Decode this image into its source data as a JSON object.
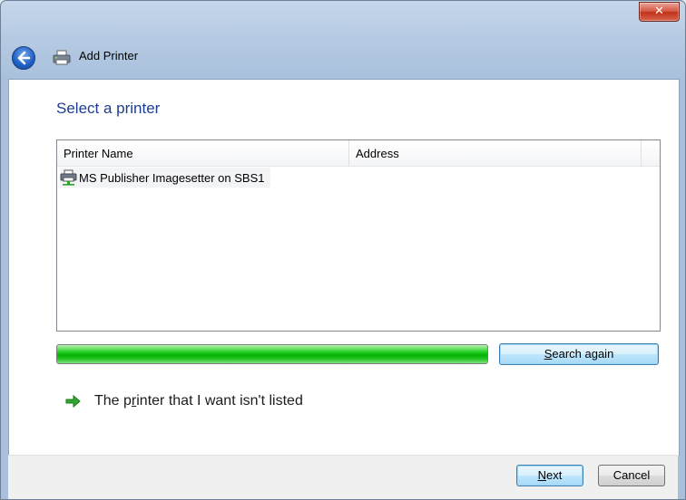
{
  "window": {
    "title": "Add Printer",
    "close_symbol": "✕"
  },
  "icons": {
    "back": "back-arrow-icon",
    "title": "printer-icon",
    "row": "network-printer-icon",
    "link": "green-arrow-icon"
  },
  "content": {
    "instruction": "Select a printer",
    "list": {
      "columns": [
        "Printer Name",
        "Address",
        ""
      ],
      "rows": [
        {
          "name": "MS Publisher Imagesetter on SBS1",
          "address": ""
        }
      ]
    },
    "progress": {
      "value": 1.0
    },
    "search_button": {
      "pre": "",
      "mnemonic": "S",
      "post": "earch again"
    },
    "link": {
      "pre": "The p",
      "mnemonic": "r",
      "post": "inter that I want isn't listed"
    }
  },
  "footer": {
    "next": {
      "pre": "",
      "mnemonic": "N",
      "post": "ext"
    },
    "cancel": "Cancel"
  },
  "colors": {
    "instruction": "#1e3d8f",
    "progress": "#04b204",
    "close": "#c7432c"
  }
}
